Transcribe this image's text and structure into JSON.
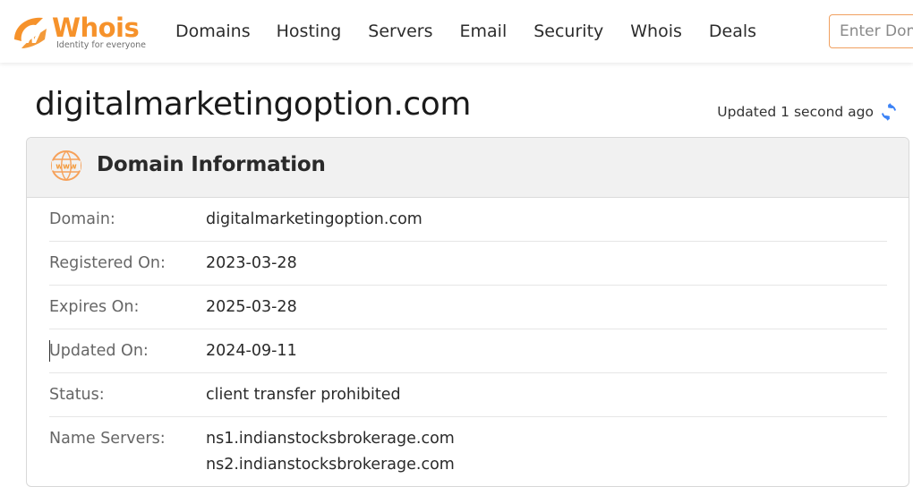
{
  "brand": {
    "name": "Whois",
    "tagline": "Identity for everyone",
    "color": "#f6922b"
  },
  "nav": {
    "items": [
      "Domains",
      "Hosting",
      "Servers",
      "Email",
      "Security",
      "Whois",
      "Deals"
    ]
  },
  "search": {
    "placeholder": "Enter Domain"
  },
  "page": {
    "title": "digitalmarketingoption.com",
    "updated": "Updated 1 second ago"
  },
  "domain_info": {
    "heading": "Domain Information",
    "rows": [
      {
        "label": "Domain:",
        "values": [
          "digitalmarketingoption.com"
        ]
      },
      {
        "label": "Registered On:",
        "values": [
          "2023-03-28"
        ]
      },
      {
        "label": "Expires On:",
        "values": [
          "2025-03-28"
        ]
      },
      {
        "label": "Updated On:",
        "values": [
          "2024-09-11"
        ]
      },
      {
        "label": "Status:",
        "values": [
          "client transfer prohibited"
        ]
      },
      {
        "label": "Name Servers:",
        "values": [
          "ns1.indianstocksbrokerage.com",
          "ns2.indianstocksbrokerage.com"
        ]
      }
    ]
  }
}
